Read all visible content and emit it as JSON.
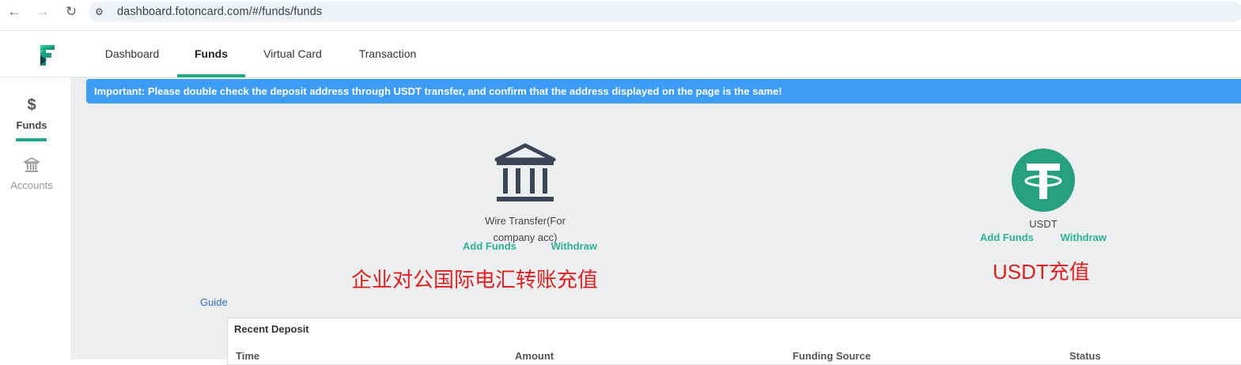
{
  "browser": {
    "url": "dashboard.fotoncard.com/#/funds/funds",
    "back_icon": "←",
    "forward_icon": "→",
    "reload_icon": "↻",
    "site_info_icon": "⚙"
  },
  "topnav": {
    "tabs": [
      "Dashboard",
      "Funds",
      "Virtual Card",
      "Transaction"
    ],
    "active_tab": "Funds"
  },
  "sidebar": {
    "funds_icon": "$",
    "funds_label": "Funds",
    "accounts_icon": "🏛",
    "accounts_label": "Accounts"
  },
  "banner": {
    "text": "Important: Please double check the deposit address through USDT transfer, and confirm that the address displayed on the page is the same!"
  },
  "wire": {
    "label_line1": "Wire Transfer(For",
    "label_line2": "company acc)",
    "add_funds": "Add Funds",
    "withdraw": "Withdraw",
    "annotation": "企业对公国际电汇转账充值"
  },
  "usdt": {
    "label": "USDT",
    "add_funds": "Add Funds",
    "withdraw": "Withdraw",
    "annotation": "USDT充值"
  },
  "guide": "Guide",
  "recent_deposit": {
    "title": "Recent Deposit",
    "columns": [
      "Time",
      "Amount",
      "Funding Source",
      "Status"
    ]
  },
  "colors": {
    "accent": "#1fa88a",
    "banner": "#3d9cf5",
    "link": "#2bb58e",
    "annotation": "#e02020",
    "usdt_circle": "#26a17b"
  }
}
